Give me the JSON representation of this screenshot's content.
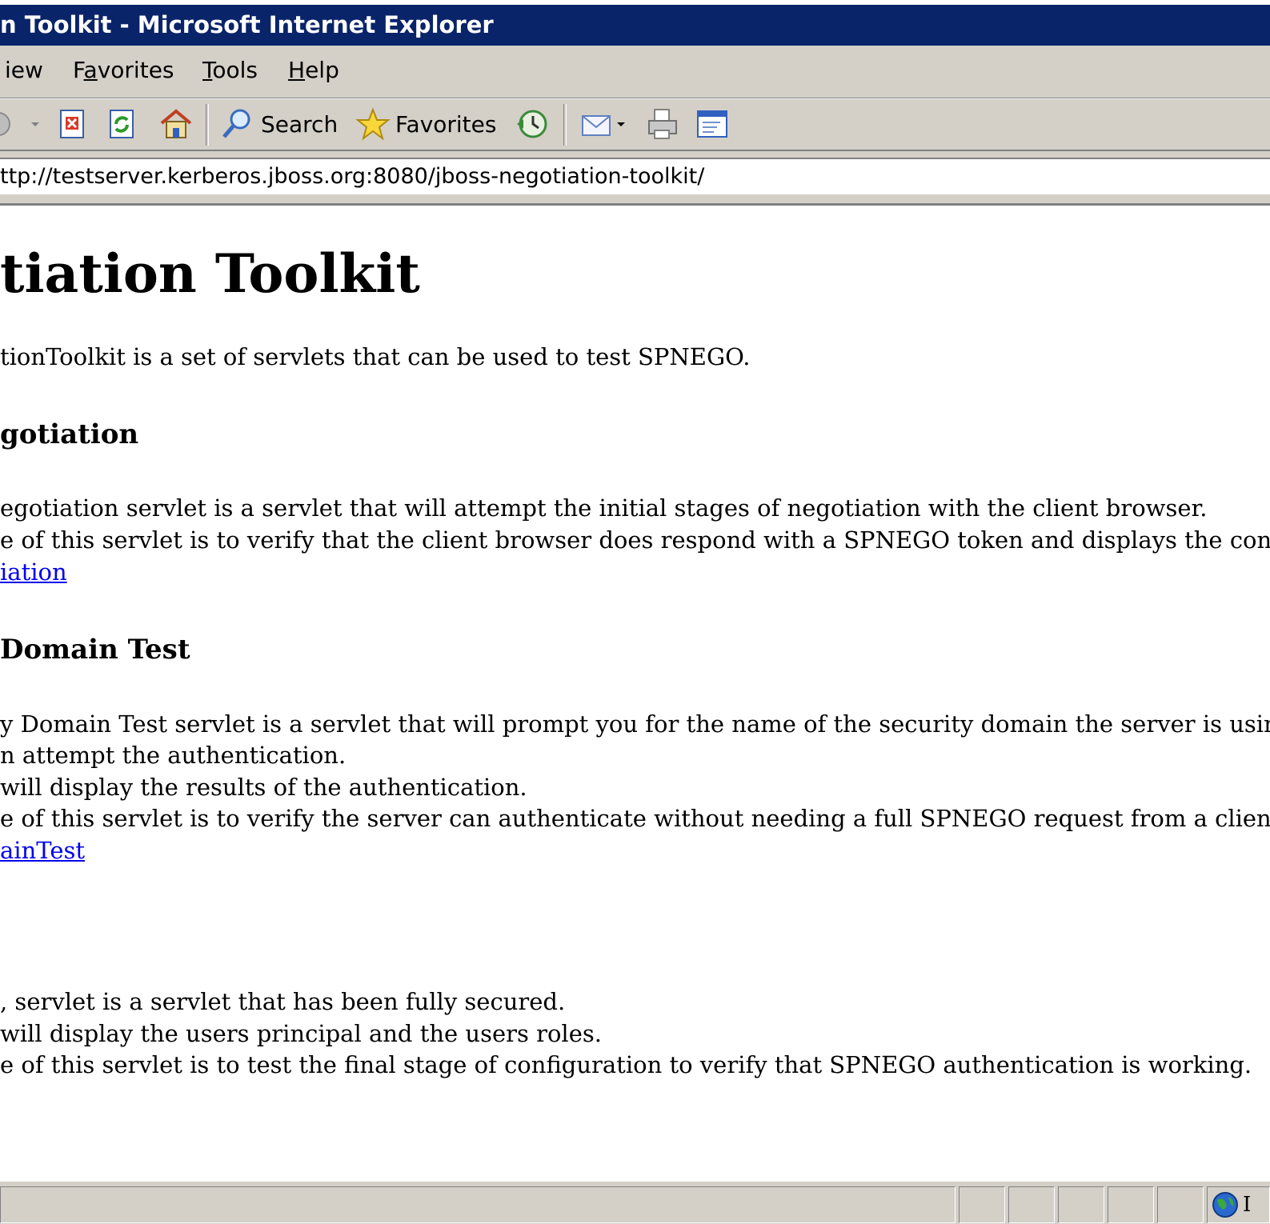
{
  "window": {
    "title": "n Toolkit - Microsoft Internet Explorer"
  },
  "menu": {
    "items": [
      {
        "label": "View",
        "accesskey": "V"
      },
      {
        "label": "Favorites",
        "accesskey": "a"
      },
      {
        "label": "Tools",
        "accesskey": "T"
      },
      {
        "label": "Help",
        "accesskey": "H"
      }
    ]
  },
  "toolbar": {
    "search_label": "Search",
    "favorites_label": "Favorites",
    "icons": [
      "forward-icon",
      "stop-icon",
      "refresh-icon",
      "home-icon",
      "search-icon",
      "favorites-star-icon",
      "history-icon",
      "mail-icon",
      "print-icon",
      "edit-icon"
    ]
  },
  "address": {
    "value": "ttp://testserver.kerberos.jboss.org:8080/jboss-negotiation-toolkit/"
  },
  "page": {
    "title": "tiation Toolkit",
    "intro": "tionToolkit is a set of servlets that can be used to test SPNEGO.",
    "sections": [
      {
        "heading": "gotiation",
        "lines": [
          "egotiation servlet is a servlet that will attempt the initial stages of negotiation with the client browser.",
          "e of this servlet is to verify that the client browser does respond with a SPNEGO token and displays the contents"
        ],
        "link": "iation"
      },
      {
        "heading": "Domain Test",
        "lines": [
          "y Domain Test servlet is a servlet that will prompt you for the name of the security domain the server is using to a",
          "n attempt the authentication.",
          "will display the results of the authentication.",
          "e of this servlet is to verify the server can authenticate without needing a full SPNEGO request from a client."
        ],
        "link": "ainTest"
      },
      {
        "heading": "",
        "lines": [
          ", servlet is a servlet that has been fully secured.",
          "will display the users principal and the users roles.",
          "e of this servlet is to test the final stage of configuration to verify that SPNEGO authentication is working."
        ],
        "link": ""
      }
    ]
  },
  "status": {
    "zone_text": "I"
  },
  "colors": {
    "titlebar": "#0a246a",
    "chrome": "#d4d0c8",
    "link": "#0000ee"
  }
}
